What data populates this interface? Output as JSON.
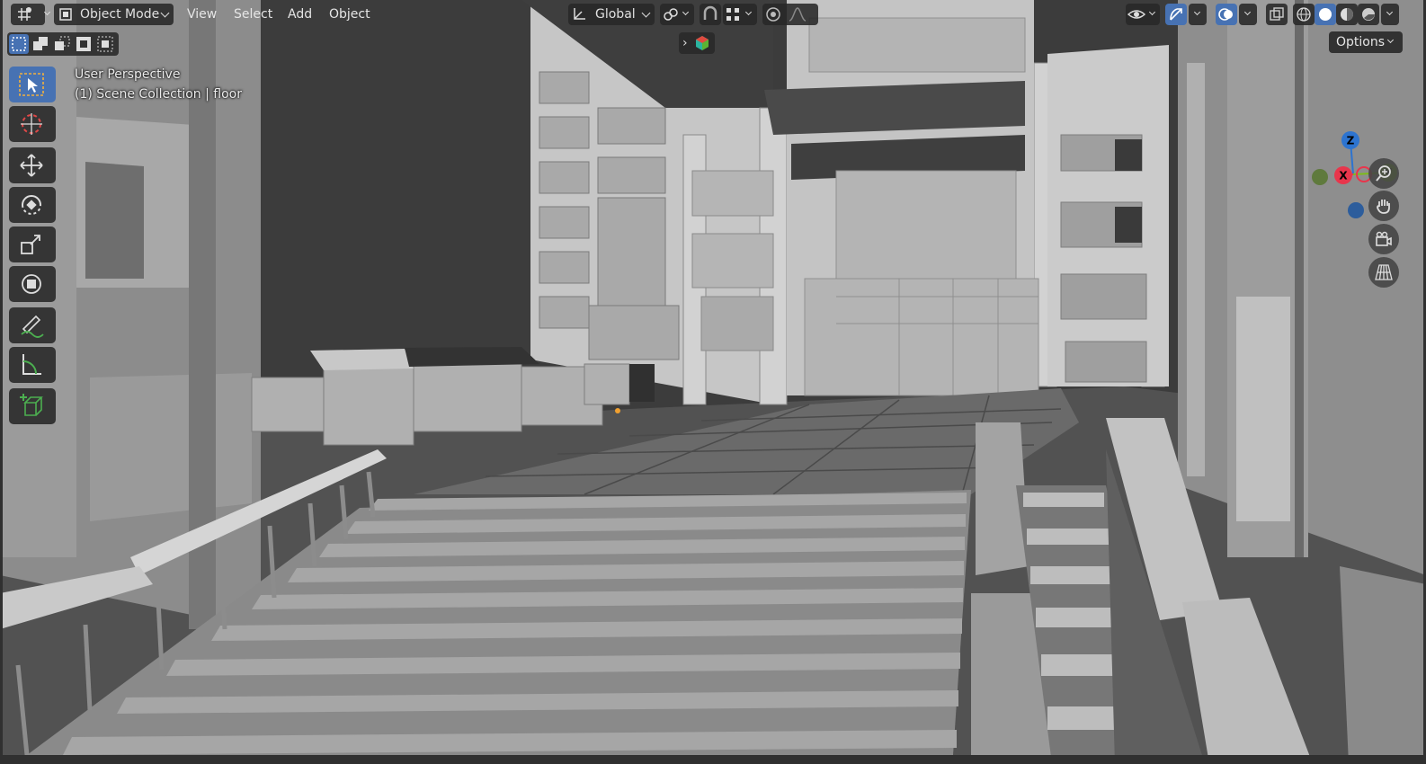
{
  "header": {
    "mode": {
      "label": "Object Mode",
      "icon": "object-mode-icon"
    },
    "menus": [
      "View",
      "Select",
      "Add",
      "Object"
    ],
    "transform_orientation": {
      "label": "Global",
      "icon": "transform-orientation-icon"
    },
    "options_label": "Options"
  },
  "viewport_overlay": {
    "view_name": "User Perspective",
    "collection_object": "(1) Scene Collection | floor"
  },
  "toolbar": {
    "tools": [
      "select-box",
      "cursor",
      "move",
      "rotate",
      "scale",
      "transform",
      "annotate",
      "measure",
      "add-cube"
    ],
    "active_tool": "select-box"
  },
  "gizmo": {
    "axes": [
      "Z",
      "X",
      "Y"
    ]
  },
  "colors": {
    "accent": "#4772b3",
    "axis_x": "#e8364c",
    "axis_y": "#7dbd1a",
    "axis_z": "#2d74d0"
  }
}
